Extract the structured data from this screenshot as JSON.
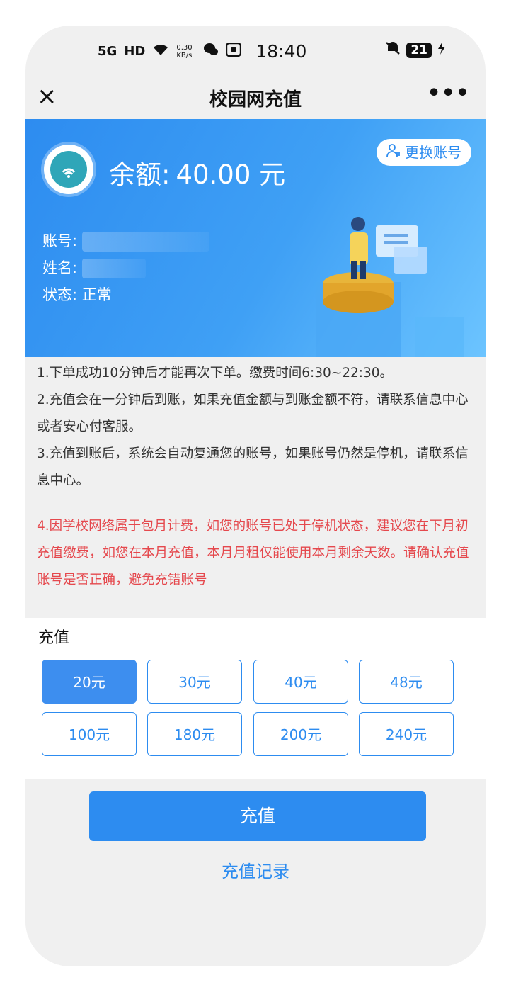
{
  "status_bar": {
    "signal": "5G",
    "hd": "HD",
    "speed": "0.30 KB/s",
    "time": "18:40",
    "battery": "21"
  },
  "nav": {
    "close": "×",
    "title": "校园网充值",
    "more": "•••"
  },
  "account": {
    "balance_label": "余额:",
    "balance_value": "40.00 元",
    "switch_label": "更换账号",
    "account_label": "账号:",
    "name_label": "姓名:",
    "status_label": "状态:",
    "status_value": "正常"
  },
  "notices": [
    "1.下单成功10分钟后才能再次下单。缴费时间6:30~22:30。",
    "2.充值会在一分钟后到账，如果充值金额与到账金额不符，请联系信息中心或者安心付客服。",
    "3.充值到账后，系统会自动复通您的账号，如果账号仍然是停机，请联系信息中心。",
    "4.因学校网络属于包月计费，如您的账号已处于停机状态，建议您在下月初充值缴费，如您在本月充值，本月月租仅能使用本月剩余天数。请确认充值账号是否正确，避免充错账号"
  ],
  "recharge": {
    "label": "充值",
    "options": [
      "20元",
      "30元",
      "40元",
      "48元",
      "100元",
      "180元",
      "200元",
      "240元"
    ],
    "selected": "20元"
  },
  "actions": {
    "pay": "充值",
    "history": "充值记录"
  },
  "colors": {
    "primary": "#2d8cf0",
    "warning": "#e5484d"
  }
}
